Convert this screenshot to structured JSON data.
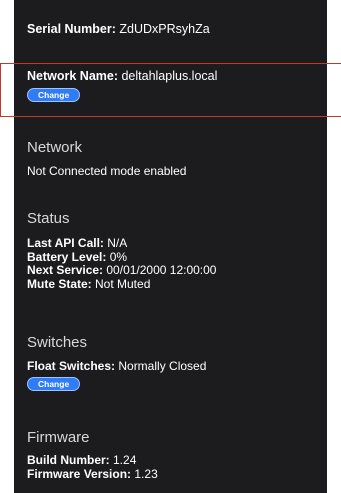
{
  "device": {
    "serial_label": "Serial Number:",
    "serial_value": " ZdUDxPRsyhZa",
    "network_name_label": "Network Name:",
    "network_name_value": " deltahlaplus.local",
    "network_change_label": "Change"
  },
  "network": {
    "title": "Network",
    "status_text": "Not Connected mode enabled"
  },
  "status": {
    "title": "Status",
    "last_api_label": "Last API Call:",
    "last_api_value": " N/A",
    "battery_label": "Battery Level:",
    "battery_value": " 0%",
    "next_service_label": "Next Service:",
    "next_service_value": " 00/01/2000 12:00:00",
    "mute_label": "Mute State:",
    "mute_value": " Not Muted"
  },
  "switches": {
    "title": "Switches",
    "float_label": "Float Switches:",
    "float_value": " Normally Closed",
    "change_label": "Change"
  },
  "firmware": {
    "title": "Firmware",
    "build_label": "Build Number:",
    "build_value": " 1.24",
    "version_label": "Firmware Version:",
    "version_value": " 1.23"
  },
  "colors": {
    "panel_bg": "#1c1c1e",
    "button_blue": "#2f7cf6",
    "highlight_red": "#c0392b"
  }
}
